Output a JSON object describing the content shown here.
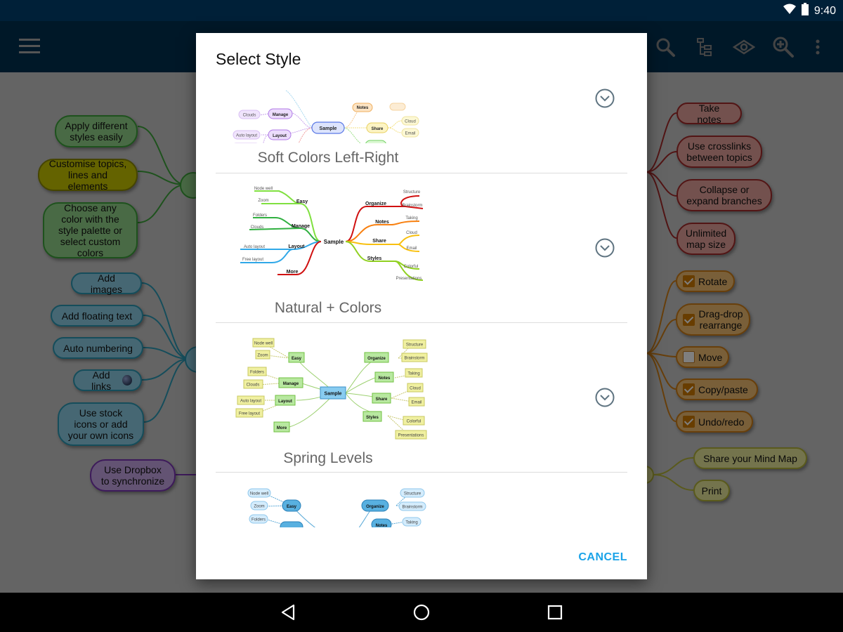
{
  "status_bar": {
    "time": "9:40",
    "icons": [
      "wifi-icon",
      "battery-icon"
    ]
  },
  "app_bar": {
    "menu_icon": "hamburger-menu-icon",
    "actions": [
      "search-icon",
      "tree-view-icon",
      "eye-icon",
      "zoom-in-icon",
      "more-vert-icon"
    ]
  },
  "mind_map": {
    "left_green": [
      "Apply different styles easily",
      "Customise topics, lines and elements",
      "Choose any color with the style palette or select custom colors"
    ],
    "left_blue": [
      "Add images",
      "Add floating text",
      "Auto numbering",
      "Add links",
      "Use stock icons or add your own icons"
    ],
    "left_purple": [
      "Use Dropbox to synchronize"
    ],
    "right_red": [
      "Take notes",
      "Use crosslinks between topics",
      "Collapse or expand branches",
      "Unlimited map size"
    ],
    "right_orange": [
      {
        "label": "Rotate",
        "checked": true
      },
      {
        "label": "Drag-drop rearrange",
        "checked": true
      },
      {
        "label": "Move",
        "checked": false
      },
      {
        "label": "Copy/paste",
        "checked": true
      },
      {
        "label": "Undo/redo",
        "checked": true
      }
    ],
    "right_yellow": [
      "Share your Mind Map",
      "Print"
    ]
  },
  "dialog": {
    "title": "Select Style",
    "styles": [
      {
        "name": "Soft Colors Left-Right"
      },
      {
        "name": "Natural + Colors"
      },
      {
        "name": "Spring Levels"
      },
      {
        "name": ""
      }
    ],
    "preview_labels": {
      "center": "Sample",
      "left": [
        "Easy",
        "Manage",
        "Layout",
        "More"
      ],
      "left_sub": [
        "Node well",
        "Zoom",
        "Folders",
        "Clouds",
        "Auto layout",
        "Free layout"
      ],
      "right": [
        "Organize",
        "Notes",
        "Share",
        "Styles"
      ],
      "right_sub": [
        "Structure",
        "Brainstorm",
        "Taking",
        "Cloud",
        "Email",
        "Colorful",
        "Presentations"
      ]
    },
    "cancel_label": "CANCEL"
  },
  "nav_bar": {
    "buttons": [
      "back-icon",
      "home-icon",
      "recents-icon"
    ]
  },
  "colors": {
    "accent": "#1aa3e8",
    "app_bar": "#003050",
    "status_bar": "#002038"
  }
}
